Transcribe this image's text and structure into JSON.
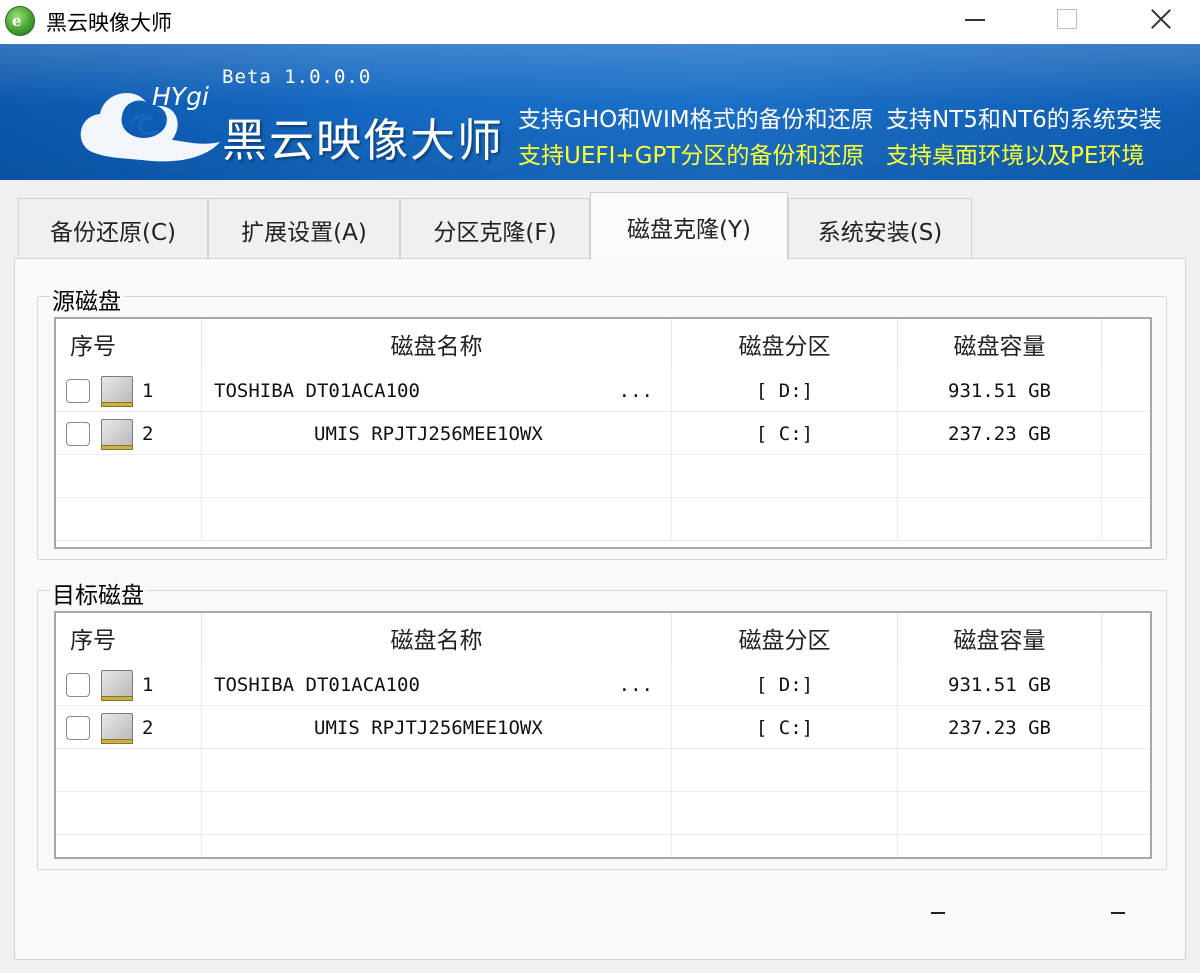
{
  "window": {
    "title": "黑云映像大师"
  },
  "banner": {
    "logo_hygi": "HYgi",
    "version": "Beta 1.0.0.0",
    "name": "黑云映像大师",
    "features": [
      {
        "text": "支持GHO和WIM格式的备份和还原",
        "color": "#ffffff"
      },
      {
        "text": "支持NT5和NT6的系统安装",
        "color": "#ffffff"
      },
      {
        "text": "支持UEFI+GPT分区的备份和还原",
        "color": "#ffff33"
      },
      {
        "text": "支持桌面环境以及PE环境",
        "color": "#ffff33"
      }
    ]
  },
  "tabs": [
    {
      "label": "备份还原(C)",
      "active": false
    },
    {
      "label": "扩展设置(A)",
      "active": false
    },
    {
      "label": "分区克隆(F)",
      "active": false
    },
    {
      "label": "磁盘克隆(Y)",
      "active": true
    },
    {
      "label": "系统安装(S)",
      "active": false
    }
  ],
  "source": {
    "title": "源磁盘",
    "columns": [
      "序号",
      "磁盘名称",
      "磁盘分区",
      "磁盘容量"
    ],
    "rows": [
      {
        "index": "1",
        "name": "TOSHIBA DT01ACA100",
        "suffix": "...",
        "partition": "[ D:]",
        "capacity": "931.51 GB",
        "checked": false
      },
      {
        "index": "2",
        "name": "UMIS RPJTJ256MEE1OWX",
        "suffix": "",
        "partition": "[ C:]",
        "capacity": "237.23 GB",
        "checked": false
      }
    ]
  },
  "target": {
    "title": "目标磁盘",
    "columns": [
      "序号",
      "磁盘名称",
      "磁盘分区",
      "磁盘容量"
    ],
    "rows": [
      {
        "index": "1",
        "name": "TOSHIBA DT01ACA100",
        "suffix": "...",
        "partition": "[ D:]",
        "capacity": "931.51 GB",
        "checked": false
      },
      {
        "index": "2",
        "name": "UMIS RPJTJ256MEE1OWX",
        "suffix": "",
        "partition": "[ C:]",
        "capacity": "237.23 GB",
        "checked": false
      }
    ]
  },
  "footer": {
    "left_dash": "-",
    "right_dash": "-"
  },
  "colors": {
    "banner_blue": "#1468c2",
    "feature_white": "#ffffff",
    "feature_yellow": "#ffff33"
  }
}
